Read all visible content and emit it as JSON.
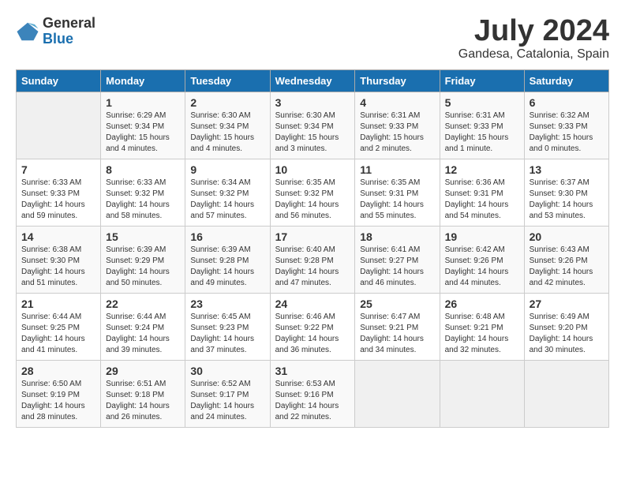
{
  "logo": {
    "general": "General",
    "blue": "Blue"
  },
  "title": {
    "month_year": "July 2024",
    "location": "Gandesa, Catalonia, Spain"
  },
  "calendar": {
    "days_of_week": [
      "Sunday",
      "Monday",
      "Tuesday",
      "Wednesday",
      "Thursday",
      "Friday",
      "Saturday"
    ],
    "weeks": [
      [
        {
          "day": "",
          "sunrise": "",
          "sunset": "",
          "daylight": ""
        },
        {
          "day": "1",
          "sunrise": "Sunrise: 6:29 AM",
          "sunset": "Sunset: 9:34 PM",
          "daylight": "Daylight: 15 hours and 4 minutes."
        },
        {
          "day": "2",
          "sunrise": "Sunrise: 6:30 AM",
          "sunset": "Sunset: 9:34 PM",
          "daylight": "Daylight: 15 hours and 4 minutes."
        },
        {
          "day": "3",
          "sunrise": "Sunrise: 6:30 AM",
          "sunset": "Sunset: 9:34 PM",
          "daylight": "Daylight: 15 hours and 3 minutes."
        },
        {
          "day": "4",
          "sunrise": "Sunrise: 6:31 AM",
          "sunset": "Sunset: 9:33 PM",
          "daylight": "Daylight: 15 hours and 2 minutes."
        },
        {
          "day": "5",
          "sunrise": "Sunrise: 6:31 AM",
          "sunset": "Sunset: 9:33 PM",
          "daylight": "Daylight: 15 hours and 1 minute."
        },
        {
          "day": "6",
          "sunrise": "Sunrise: 6:32 AM",
          "sunset": "Sunset: 9:33 PM",
          "daylight": "Daylight: 15 hours and 0 minutes."
        }
      ],
      [
        {
          "day": "7",
          "sunrise": "Sunrise: 6:33 AM",
          "sunset": "Sunset: 9:33 PM",
          "daylight": "Daylight: 14 hours and 59 minutes."
        },
        {
          "day": "8",
          "sunrise": "Sunrise: 6:33 AM",
          "sunset": "Sunset: 9:32 PM",
          "daylight": "Daylight: 14 hours and 58 minutes."
        },
        {
          "day": "9",
          "sunrise": "Sunrise: 6:34 AM",
          "sunset": "Sunset: 9:32 PM",
          "daylight": "Daylight: 14 hours and 57 minutes."
        },
        {
          "day": "10",
          "sunrise": "Sunrise: 6:35 AM",
          "sunset": "Sunset: 9:32 PM",
          "daylight": "Daylight: 14 hours and 56 minutes."
        },
        {
          "day": "11",
          "sunrise": "Sunrise: 6:35 AM",
          "sunset": "Sunset: 9:31 PM",
          "daylight": "Daylight: 14 hours and 55 minutes."
        },
        {
          "day": "12",
          "sunrise": "Sunrise: 6:36 AM",
          "sunset": "Sunset: 9:31 PM",
          "daylight": "Daylight: 14 hours and 54 minutes."
        },
        {
          "day": "13",
          "sunrise": "Sunrise: 6:37 AM",
          "sunset": "Sunset: 9:30 PM",
          "daylight": "Daylight: 14 hours and 53 minutes."
        }
      ],
      [
        {
          "day": "14",
          "sunrise": "Sunrise: 6:38 AM",
          "sunset": "Sunset: 9:30 PM",
          "daylight": "Daylight: 14 hours and 51 minutes."
        },
        {
          "day": "15",
          "sunrise": "Sunrise: 6:39 AM",
          "sunset": "Sunset: 9:29 PM",
          "daylight": "Daylight: 14 hours and 50 minutes."
        },
        {
          "day": "16",
          "sunrise": "Sunrise: 6:39 AM",
          "sunset": "Sunset: 9:28 PM",
          "daylight": "Daylight: 14 hours and 49 minutes."
        },
        {
          "day": "17",
          "sunrise": "Sunrise: 6:40 AM",
          "sunset": "Sunset: 9:28 PM",
          "daylight": "Daylight: 14 hours and 47 minutes."
        },
        {
          "day": "18",
          "sunrise": "Sunrise: 6:41 AM",
          "sunset": "Sunset: 9:27 PM",
          "daylight": "Daylight: 14 hours and 46 minutes."
        },
        {
          "day": "19",
          "sunrise": "Sunrise: 6:42 AM",
          "sunset": "Sunset: 9:26 PM",
          "daylight": "Daylight: 14 hours and 44 minutes."
        },
        {
          "day": "20",
          "sunrise": "Sunrise: 6:43 AM",
          "sunset": "Sunset: 9:26 PM",
          "daylight": "Daylight: 14 hours and 42 minutes."
        }
      ],
      [
        {
          "day": "21",
          "sunrise": "Sunrise: 6:44 AM",
          "sunset": "Sunset: 9:25 PM",
          "daylight": "Daylight: 14 hours and 41 minutes."
        },
        {
          "day": "22",
          "sunrise": "Sunrise: 6:44 AM",
          "sunset": "Sunset: 9:24 PM",
          "daylight": "Daylight: 14 hours and 39 minutes."
        },
        {
          "day": "23",
          "sunrise": "Sunrise: 6:45 AM",
          "sunset": "Sunset: 9:23 PM",
          "daylight": "Daylight: 14 hours and 37 minutes."
        },
        {
          "day": "24",
          "sunrise": "Sunrise: 6:46 AM",
          "sunset": "Sunset: 9:22 PM",
          "daylight": "Daylight: 14 hours and 36 minutes."
        },
        {
          "day": "25",
          "sunrise": "Sunrise: 6:47 AM",
          "sunset": "Sunset: 9:21 PM",
          "daylight": "Daylight: 14 hours and 34 minutes."
        },
        {
          "day": "26",
          "sunrise": "Sunrise: 6:48 AM",
          "sunset": "Sunset: 9:21 PM",
          "daylight": "Daylight: 14 hours and 32 minutes."
        },
        {
          "day": "27",
          "sunrise": "Sunrise: 6:49 AM",
          "sunset": "Sunset: 9:20 PM",
          "daylight": "Daylight: 14 hours and 30 minutes."
        }
      ],
      [
        {
          "day": "28",
          "sunrise": "Sunrise: 6:50 AM",
          "sunset": "Sunset: 9:19 PM",
          "daylight": "Daylight: 14 hours and 28 minutes."
        },
        {
          "day": "29",
          "sunrise": "Sunrise: 6:51 AM",
          "sunset": "Sunset: 9:18 PM",
          "daylight": "Daylight: 14 hours and 26 minutes."
        },
        {
          "day": "30",
          "sunrise": "Sunrise: 6:52 AM",
          "sunset": "Sunset: 9:17 PM",
          "daylight": "Daylight: 14 hours and 24 minutes."
        },
        {
          "day": "31",
          "sunrise": "Sunrise: 6:53 AM",
          "sunset": "Sunset: 9:16 PM",
          "daylight": "Daylight: 14 hours and 22 minutes."
        },
        {
          "day": "",
          "sunrise": "",
          "sunset": "",
          "daylight": ""
        },
        {
          "day": "",
          "sunrise": "",
          "sunset": "",
          "daylight": ""
        },
        {
          "day": "",
          "sunrise": "",
          "sunset": "",
          "daylight": ""
        }
      ]
    ]
  }
}
